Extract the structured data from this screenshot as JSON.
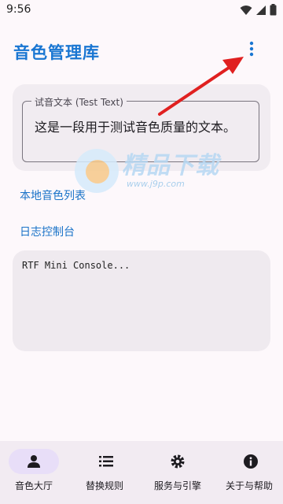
{
  "status_bar": {
    "time": "9:56",
    "icons": [
      "wifi-icon",
      "signal-icon",
      "battery-icon"
    ]
  },
  "app_bar": {
    "title": "音色管理库",
    "overflow_icon": "more-vert-icon"
  },
  "test_text": {
    "label": "试音文本 (Test Text)",
    "value": "这是一段用于测试音色质量的文本。"
  },
  "links": {
    "local_voices": "本地音色列表",
    "log_console": "日志控制台"
  },
  "console": {
    "text": "RTF Mini Console..."
  },
  "bottom_nav": {
    "items": [
      {
        "label": "音色大厅",
        "icon": "person-icon",
        "selected": true
      },
      {
        "label": "替换规则",
        "icon": "list-icon",
        "selected": false
      },
      {
        "label": "服务与引擎",
        "icon": "gear-icon",
        "selected": false
      },
      {
        "label": "关于与帮助",
        "icon": "info-icon",
        "selected": false
      }
    ]
  },
  "watermark": {
    "title": "精品下载",
    "subtitle": "www.j9p.com"
  },
  "colors": {
    "accent": "#1976d2",
    "link": "#1a73c8",
    "annotation_arrow": "#e02020",
    "nav_active_pill": "#e8def8"
  }
}
